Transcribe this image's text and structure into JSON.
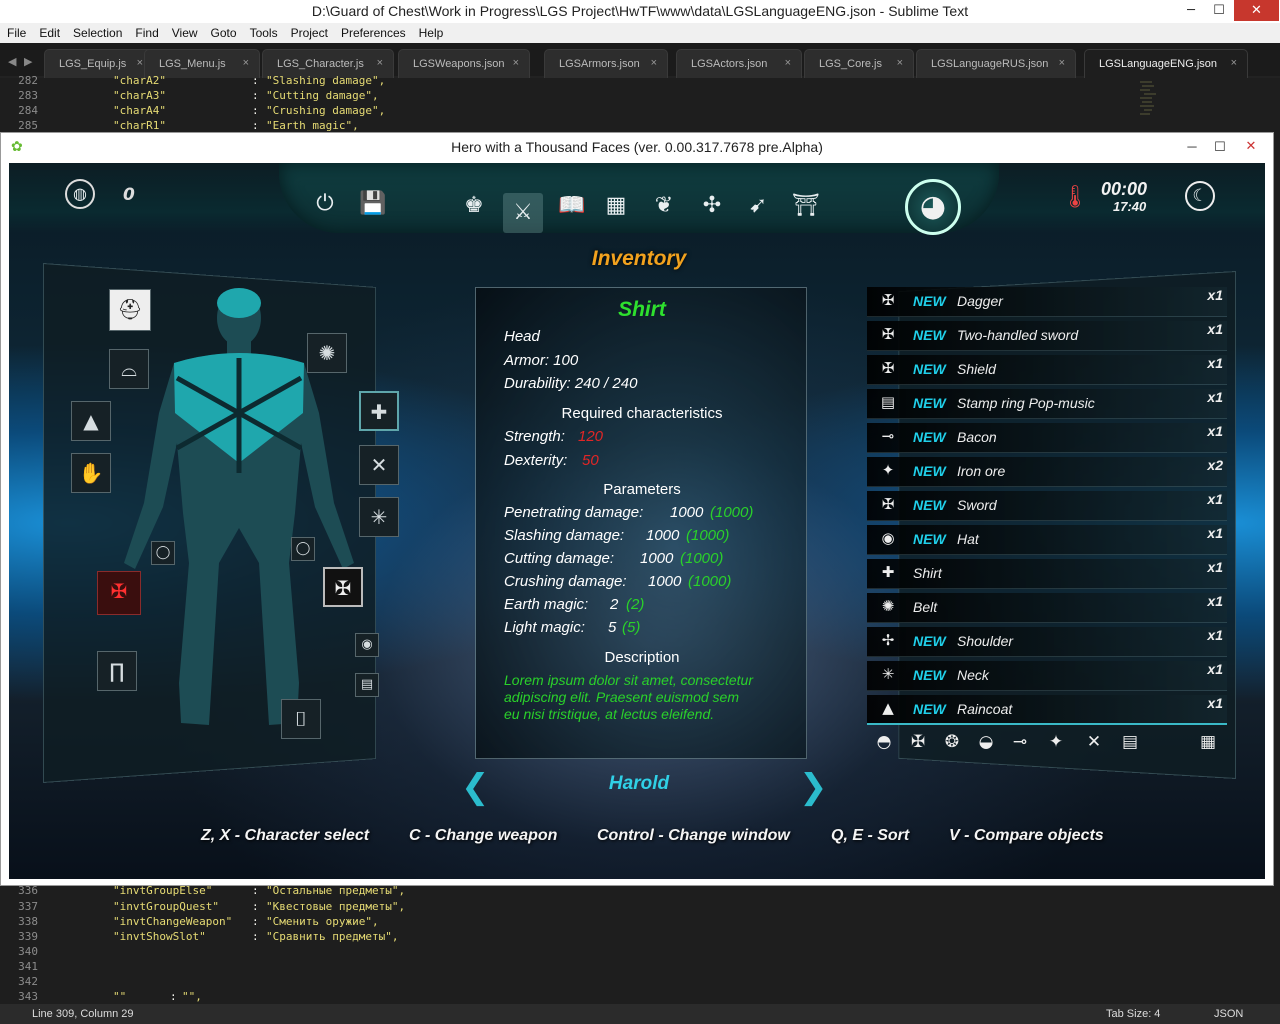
{
  "editor": {
    "title": "D:\\Guard of Chest\\Work in Progress\\LGS Project\\HwTF\\www\\data\\LGSLanguageENG.json - Sublime Text",
    "menu": [
      "File",
      "Edit",
      "Selection",
      "Find",
      "View",
      "Goto",
      "Tools",
      "Project",
      "Preferences",
      "Help"
    ],
    "tabs": [
      {
        "label": "LGS_Equip.js",
        "active": false
      },
      {
        "label": "LGS_Menu.js",
        "active": false
      },
      {
        "label": "LGS_Character.js",
        "active": false
      },
      {
        "label": "LGSWeapons.json",
        "active": false
      },
      {
        "label": "LGSArmors.json",
        "active": false
      },
      {
        "label": "LGSActors.json",
        "active": false
      },
      {
        "label": "LGS_Core.js",
        "active": false
      },
      {
        "label": "LGSLanguageRUS.json",
        "active": false
      },
      {
        "label": "LGSLanguageENG.json",
        "active": true
      }
    ],
    "tab_close_glyph": "×",
    "tab_nav": [
      "◀",
      "▶"
    ],
    "code_top": [
      {
        "ln": "282",
        "key": "\"charA2\"",
        "colon": ":",
        "val": "\"Slashing damage\","
      },
      {
        "ln": "283",
        "key": "\"charA3\"",
        "colon": ":",
        "val": "\"Cutting damage\","
      },
      {
        "ln": "284",
        "key": "\"charA4\"",
        "colon": ":",
        "val": "\"Crushing damage\","
      },
      {
        "ln": "285",
        "key": "\"charR1\"",
        "colon": ":",
        "val": "\"Earth magic\","
      }
    ],
    "code_bottom": [
      {
        "ln": "336",
        "key": "\"invtGroupElse\"",
        "colon": ":",
        "val": "\"Остальные предметы\","
      },
      {
        "ln": "337",
        "key": "\"invtGroupQuest\"",
        "colon": ":",
        "val": "\"Квестовые предметы\","
      },
      {
        "ln": "338",
        "key": "\"invtChangeWeapon\"",
        "colon": ":",
        "val": "\"Сменить оружие\","
      },
      {
        "ln": "339",
        "key": "\"invtShowSlot\"",
        "colon": ":",
        "val": "\"Сравнить предметы\","
      },
      {
        "ln": "340",
        "key": "",
        "colon": "",
        "val": ""
      },
      {
        "ln": "341",
        "key": "",
        "colon": "",
        "val": ""
      },
      {
        "ln": "342",
        "key": "",
        "colon": "",
        "val": ""
      },
      {
        "ln": "343",
        "key": "\"\"",
        "colon": ":",
        "val": "\"\","
      }
    ],
    "status": {
      "position": "Line 309, Column 29",
      "tab_size": "Tab Size: 4",
      "syntax": "JSON"
    }
  },
  "window_buttons": {
    "minimize": "─",
    "maximize": "☐",
    "close": "✕"
  },
  "game": {
    "title": "Hero with a Thousand Faces (ver. 0.00.317.7678 pre.Alpha)",
    "gold": "0",
    "time_main": "00:00",
    "time_sub": "17:40",
    "screen_title": "Inventory",
    "toolbar_icons": [
      "power-icon",
      "save-icon",
      "character-icon",
      "inventory-icon",
      "book-icon",
      "card-icon",
      "bird-icon",
      "tree-icon",
      "archer-icon",
      "gate-icon"
    ],
    "item": {
      "name": "Shirt",
      "slot": "Head",
      "armor": "Armor: 100",
      "durability": "Durability: 240 / 240",
      "req_header": "Required characteristics",
      "req": [
        {
          "label": "Strength:",
          "value": "120"
        },
        {
          "label": "Dexterity:",
          "value": "50"
        }
      ],
      "params_header": "Parameters",
      "params": [
        {
          "label": "Penetrating damage:",
          "value": "1000",
          "cmp": "(1000)"
        },
        {
          "label": "Slashing damage:",
          "value": "1000",
          "cmp": "(1000)"
        },
        {
          "label": "Cutting damage:",
          "value": "1000",
          "cmp": "(1000)"
        },
        {
          "label": "Crushing damage:",
          "value": "1000",
          "cmp": "(1000)"
        },
        {
          "label": "Earth magic:",
          "value": "2",
          "cmp": "(2)"
        },
        {
          "label": "Light magic:",
          "value": "5",
          "cmp": "(5)"
        }
      ],
      "desc_header": "Description",
      "description": [
        "Lorem ipsum dolor sit amet, consectetur",
        "adipiscing elit. Praesent euismod sem",
        "eu nisi tristique, at lectus eleifend."
      ]
    },
    "inventory": [
      {
        "icon": "✠",
        "new": "NEW",
        "name": "Dagger",
        "qty": "x1"
      },
      {
        "icon": "✠",
        "new": "NEW",
        "name": "Two-handled sword",
        "qty": "x1"
      },
      {
        "icon": "✠",
        "new": "NEW",
        "name": "Shield",
        "qty": "x1"
      },
      {
        "icon": "▤",
        "new": "NEW",
        "name": "Stamp ring Pop-music",
        "qty": "x1"
      },
      {
        "icon": "⊸",
        "new": "NEW",
        "name": "Bacon",
        "qty": "x1"
      },
      {
        "icon": "✦",
        "new": "NEW",
        "name": "Iron ore",
        "qty": "x2"
      },
      {
        "icon": "✠",
        "new": "NEW",
        "name": "Sword",
        "qty": "x1"
      },
      {
        "icon": "◉",
        "new": "NEW",
        "name": "Hat",
        "qty": "x1"
      },
      {
        "icon": "✚",
        "new": "",
        "name": "Shirt",
        "qty": "x1"
      },
      {
        "icon": "✺",
        "new": "",
        "name": "Belt",
        "qty": "x1"
      },
      {
        "icon": "✢",
        "new": "NEW",
        "name": "Shoulder",
        "qty": "x1"
      },
      {
        "icon": "✳",
        "new": "NEW",
        "name": "Neck",
        "qty": "x1"
      },
      {
        "icon": "▲",
        "new": "NEW",
        "name": "Raincoat",
        "qty": "x1"
      }
    ],
    "filter_icons": [
      "◓",
      "✠",
      "❂",
      "◒",
      "⊸",
      "✦",
      "✕",
      "▤",
      "▦"
    ],
    "character_name": "Harold",
    "nav_prev": "❮",
    "nav_next": "❯",
    "hints": [
      "Z, X - Character select",
      "C - Change weapon",
      "Control - Change window",
      "Q, E - Sort",
      "V - Compare objects"
    ]
  }
}
